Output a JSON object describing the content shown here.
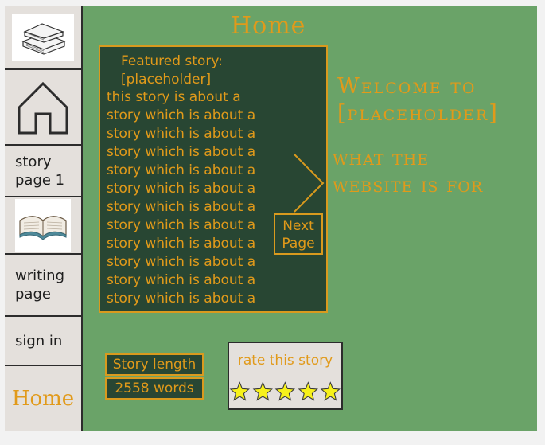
{
  "sidebar": {
    "items": [
      {
        "name": "books",
        "icon": "books-icon"
      },
      {
        "name": "home",
        "icon": "house-icon"
      },
      {
        "name": "story-page-1",
        "label": "story page 1"
      },
      {
        "name": "reading",
        "icon": "open-book-icon"
      },
      {
        "name": "writing-page",
        "label": "writing page"
      },
      {
        "name": "sign-in",
        "label": "sign in"
      }
    ],
    "home_label": "Home"
  },
  "header": {
    "title": "Home"
  },
  "featured": {
    "title_line1": "Featured story:",
    "title_line2": "[placeholder]",
    "first_line": "this story is about a",
    "repeat_line": "story which is about a",
    "repeat_count": 11,
    "next_label_line1": "Next",
    "next_label_line2": "Page"
  },
  "welcome": {
    "line1": "Welcome to",
    "line2": "[placeholder]",
    "purpose_line1": "what the",
    "purpose_line2": "website is for"
  },
  "story_length": {
    "label": "Story length",
    "value": "2558 words"
  },
  "rating": {
    "label": "rate this story",
    "stars": 5
  },
  "colors": {
    "accent": "#e19a1a",
    "background": "#6aa368",
    "panel": "#284633",
    "sidebar": "#e4e0dc",
    "star": "#f7f11a"
  }
}
